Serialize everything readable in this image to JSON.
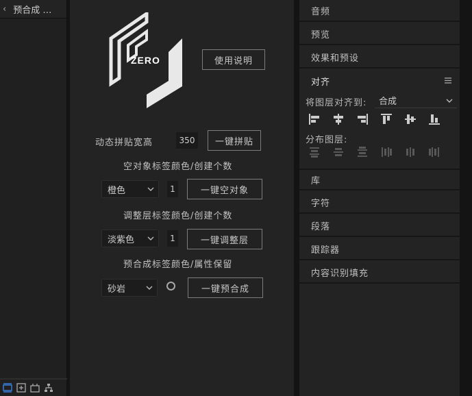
{
  "left_panel": {
    "back_glyph": "‹",
    "title": "预合成 …"
  },
  "center": {
    "help_button": "使用说明",
    "tile_label": "动态拼贴宽高",
    "tile_value": "350",
    "tile_button": "一键拼贴",
    "null_label": "空对象标签颜色/创建个数",
    "null_color": "橙色",
    "null_count": "1",
    "null_button": "一键空对象",
    "adj_label": "调整层标签颜色/创建个数",
    "adj_color": "淡紫色",
    "adj_count": "1",
    "adj_button": "一键调整层",
    "precomp_label": "预合成标签颜色/属性保留",
    "precomp_color": "砂岩",
    "precomp_button": "一键预合成"
  },
  "right_panel": {
    "audio": "音频",
    "preview": "预览",
    "effects": "效果和预设",
    "align_title": "对齐",
    "align_to_label": "将图层对齐到:",
    "align_to_value": "合成",
    "distribute_label": "分布图层:",
    "library": "库",
    "character": "字符",
    "paragraph": "段落",
    "tracker": "跟踪器",
    "content_fill": "内容识别填充"
  },
  "colors": {
    "accent_blue": "#3a7bd5",
    "panel": "#232323",
    "bg": "#141414"
  }
}
